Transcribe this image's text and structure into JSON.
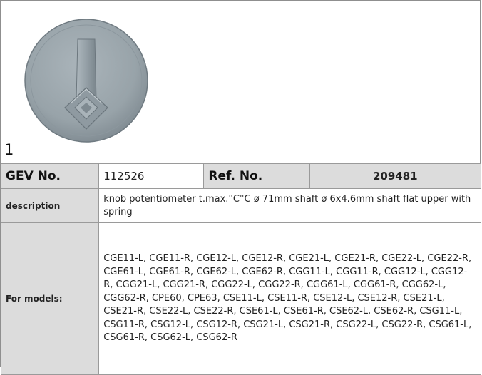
{
  "image": {
    "alt": "knob potentiometer",
    "index_label": "1"
  },
  "specs": {
    "gev_label": "GEV No.",
    "gev_value": "112526",
    "ref_label": "Ref. No.",
    "ref_value": "209481",
    "description_label": "description",
    "description_value": "knob  potentiometer t.max.°C°C ø 71mm shaft ø 6x4.6mm shaft flat upper with spring",
    "models_label": "For models:",
    "models_value": "CGE11-L, CGE11-R, CGE12-L, CGE12-R, CGE21-L, CGE21-R, CGE22-L, CGE22-R, CGE61-L, CGE61-R, CGE62-L, CGE62-R, CGG11-L, CGG11-R, CGG12-L, CGG12-R, CGG21-L, CGG21-R, CGG22-L, CGG22-R, CGG61-L, CGG61-R, CGG62-L, CGG62-R, CPE60, CPE63, CSE11-L, CSE11-R, CSE12-L, CSE12-R, CSE21-L, CSE21-R, CSE22-L, CSE22-R, CSE61-L, CSE61-R, CSE62-L, CSE62-R, CSG11-L, CSG11-R, CSG12-L, CSG12-R, CSG21-L, CSG21-R, CSG22-L, CSG22-R, CSG61-L, CSG61-R, CSG62-L, CSG62-R"
  },
  "colors": {
    "label_bg": "#dcdcdc",
    "border": "#9a9a9a",
    "knob_gray": "#98a3a9"
  }
}
